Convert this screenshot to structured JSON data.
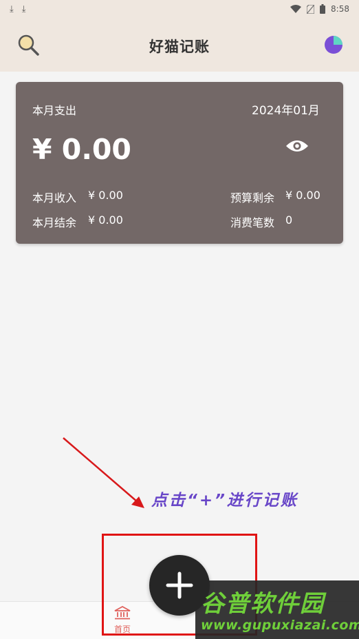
{
  "status_bar": {
    "time": "8:58"
  },
  "header": {
    "title": "好猫记账"
  },
  "summary": {
    "expense_label": "本月支出",
    "month": "2024年01月",
    "expense_amount": "¥ 0.00",
    "income_label": "本月收入",
    "income_value": "¥ 0.00",
    "budget_label": "预算剩余",
    "budget_value": "¥ 0.00",
    "balance_label": "本月结余",
    "balance_value": "¥ 0.00",
    "count_label": "消费笔数",
    "count_value": "0"
  },
  "annotation": {
    "text": "点击“+”进行记账"
  },
  "bottom_nav": {
    "home_label": "首页"
  },
  "watermark": {
    "brand": "谷普软件园",
    "url": "www.gupuxiazai.com"
  },
  "colors": {
    "header_bg": "#efe7df",
    "card_bg": "#736867",
    "fab_bg": "#262626",
    "accent_red": "#e0615c",
    "annotation_purple": "#6846c8"
  },
  "icons": [
    "download-icon",
    "wifi-icon",
    "no-sim-icon",
    "battery-icon",
    "search-icon",
    "pie-chart-icon",
    "eye-icon",
    "plus-icon",
    "bank-icon"
  ]
}
